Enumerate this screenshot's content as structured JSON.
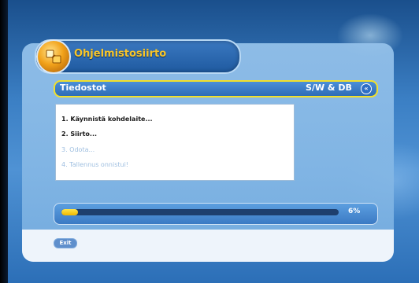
{
  "header": {
    "title": "Ohjelmistosiirto",
    "icon": "software-transfer-icon"
  },
  "tab_bar": {
    "left_label": "Tiedostot",
    "right_label": "S/W & DB",
    "icon_glyph": "«"
  },
  "steps": [
    {
      "label": "1. Käynnistä kohdelaite...",
      "state": "active"
    },
    {
      "label": "2. Siirto...",
      "state": "active"
    },
    {
      "label": "3. Odota...",
      "state": "pending"
    },
    {
      "label": "4. Tallennus onnistui!",
      "state": "pending"
    }
  ],
  "progress": {
    "percent": 6,
    "label": "6%"
  },
  "footer": {
    "exit_label": "Exit"
  },
  "colors": {
    "accent": "#f7c52a",
    "panel": "#86b8e4",
    "progress_fill": "#ffe64a"
  }
}
